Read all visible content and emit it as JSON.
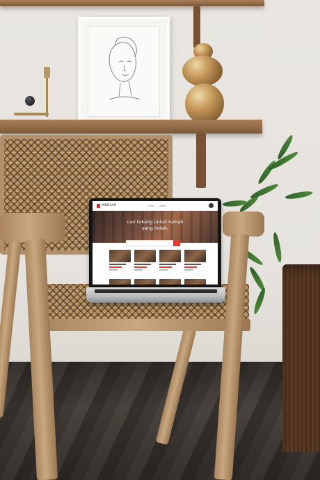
{
  "scene": {
    "description_items": [
      "wall-shelf",
      "framed-line-art",
      "gold-vase",
      "candle-holder",
      "rattan-chair",
      "laptop",
      "potted-plant",
      "fluted-side-table"
    ]
  },
  "website": {
    "brand": "MINDGAN",
    "hero_line1": "cari tukang untuk rumah",
    "hero_line2": "yang indah.",
    "accent_color": "#e53b2f",
    "card_count": 8
  }
}
